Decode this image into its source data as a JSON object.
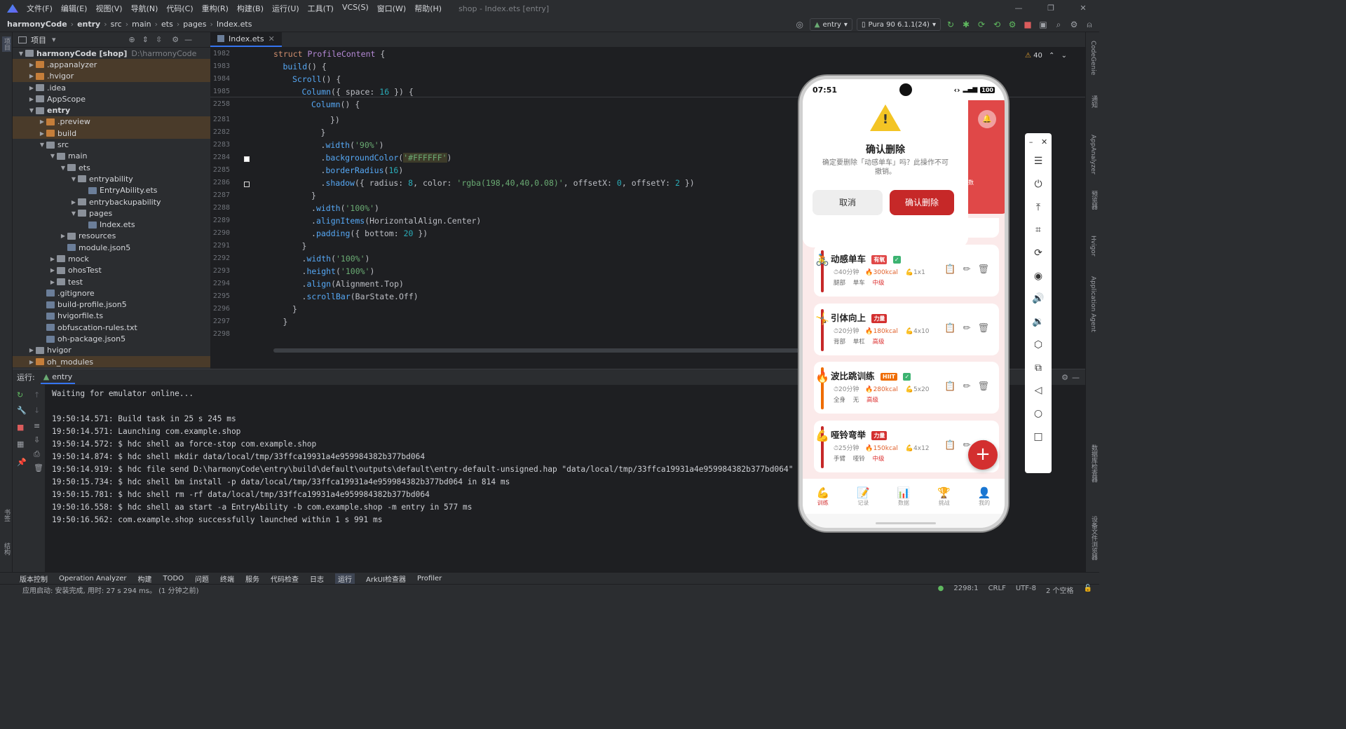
{
  "menu": {
    "items": [
      "文件(F)",
      "编辑(E)",
      "视图(V)",
      "导航(N)",
      "代码(C)",
      "重构(R)",
      "构建(B)",
      "运行(U)",
      "工具(T)",
      "VCS(S)",
      "窗口(W)",
      "帮助(H)"
    ],
    "window_title": "shop - Index.ets [entry]"
  },
  "breadcrumb": [
    "harmonyCode",
    "entry",
    "src",
    "main",
    "ets",
    "pages",
    "Index.ets"
  ],
  "toolbar": {
    "run_config": "entry",
    "device": "Pura 90 6.1.1(24)"
  },
  "left_stripe": {
    "project": "项目",
    "bookmarks": "书签",
    "structure": "结构"
  },
  "project_panel": {
    "title": "项目"
  },
  "tree": [
    {
      "label": "harmonyCode [shop]",
      "sub": "D:\\harmonyCode",
      "depth": 0,
      "type": "dir",
      "open": true,
      "hl": false
    },
    {
      "label": ".appanalyzer",
      "depth": 1,
      "type": "dir-or",
      "open": false,
      "hl": true
    },
    {
      "label": ".hvigor",
      "depth": 1,
      "type": "dir-or",
      "open": false,
      "hl": true
    },
    {
      "label": ".idea",
      "depth": 1,
      "type": "dir",
      "open": false,
      "hl": false
    },
    {
      "label": "AppScope",
      "depth": 1,
      "type": "dir",
      "open": false,
      "hl": false
    },
    {
      "label": "entry",
      "depth": 1,
      "type": "dir",
      "open": true,
      "hl": false,
      "bold": true
    },
    {
      "label": ".preview",
      "depth": 2,
      "type": "dir-or",
      "open": false,
      "hl": true
    },
    {
      "label": "build",
      "depth": 2,
      "type": "dir-or",
      "open": false,
      "hl": true
    },
    {
      "label": "src",
      "depth": 2,
      "type": "dir",
      "open": true,
      "hl": false
    },
    {
      "label": "main",
      "depth": 3,
      "type": "dir",
      "open": true,
      "hl": false
    },
    {
      "label": "ets",
      "depth": 4,
      "type": "dir",
      "open": true,
      "hl": false
    },
    {
      "label": "entryability",
      "depth": 5,
      "type": "dir",
      "open": true,
      "hl": false
    },
    {
      "label": "EntryAbility.ets",
      "depth": 6,
      "type": "file",
      "open": null,
      "hl": false
    },
    {
      "label": "entrybackupability",
      "depth": 5,
      "type": "dir",
      "open": false,
      "hl": false
    },
    {
      "label": "pages",
      "depth": 5,
      "type": "dir",
      "open": true,
      "hl": false
    },
    {
      "label": "Index.ets",
      "depth": 6,
      "type": "file",
      "open": null,
      "hl": false
    },
    {
      "label": "resources",
      "depth": 4,
      "type": "dir",
      "open": false,
      "hl": false
    },
    {
      "label": "module.json5",
      "depth": 4,
      "type": "file",
      "open": null,
      "hl": false
    },
    {
      "label": "mock",
      "depth": 3,
      "type": "dir",
      "open": false,
      "hl": false
    },
    {
      "label": "ohosTest",
      "depth": 3,
      "type": "dir",
      "open": false,
      "hl": false
    },
    {
      "label": "test",
      "depth": 3,
      "type": "dir",
      "open": false,
      "hl": false
    },
    {
      "label": ".gitignore",
      "depth": 2,
      "type": "file",
      "open": null,
      "hl": false
    },
    {
      "label": "build-profile.json5",
      "depth": 2,
      "type": "file",
      "open": null,
      "hl": false
    },
    {
      "label": "hvigorfile.ts",
      "depth": 2,
      "type": "file",
      "open": null,
      "hl": false
    },
    {
      "label": "obfuscation-rules.txt",
      "depth": 2,
      "type": "file",
      "open": null,
      "hl": false
    },
    {
      "label": "oh-package.json5",
      "depth": 2,
      "type": "file",
      "open": null,
      "hl": false
    },
    {
      "label": "hvigor",
      "depth": 1,
      "type": "dir",
      "open": false,
      "hl": false
    },
    {
      "label": "oh_modules",
      "depth": 1,
      "type": "dir-or",
      "open": false,
      "hl": true
    }
  ],
  "editor": {
    "tab": "Index.ets",
    "warnings": "40",
    "lines": [
      {
        "n": "1982",
        "html": "<span class='kw'>struct</span> <span class='ty'>ProfileContent</span> <span class='pl'>{</span>",
        "indent": 0
      },
      {
        "n": "1983",
        "html": "<span class='fn'>build</span><span class='pl'>() {</span>",
        "indent": 1
      },
      {
        "n": "1984",
        "html": "<span class='fn'>Scroll</span><span class='pl'>() {</span>",
        "indent": 2
      },
      {
        "n": "1985",
        "html": "<span class='fn'>Column</span><span class='pl'>({ space: </span><span class='nu'>16</span><span class='pl'> }) {</span>",
        "indent": 3
      },
      {
        "n": "2258",
        "html": "<span class='fn'>Column</span><span class='pl'>() {</span>",
        "indent": 4
      },
      {
        "n": "2281",
        "html": "<span class='pl'>})</span>",
        "indent": 6
      },
      {
        "n": "2282",
        "html": "<span class='pl'>}</span>",
        "indent": 5
      },
      {
        "n": "2283",
        "html": "<span class='pl'>.</span><span class='fn'>width</span><span class='pl'>(</span><span class='st'>'90%'</span><span class='pl'>)</span>",
        "indent": 5
      },
      {
        "n": "2284",
        "html": "<span class='pl'>.</span><span class='fn'>backgroundColor</span><span class='pl'>(</span><span class='st' style='background:#3d3b2a'>'#FFFFFF'</span><span class='pl'>)</span>",
        "indent": 5
      },
      {
        "n": "2285",
        "html": "<span class='pl'>.</span><span class='fn'>borderRadius</span><span class='pl'>(</span><span class='nu'>16</span><span class='pl'>)</span>",
        "indent": 5
      },
      {
        "n": "2286",
        "html": "<span class='pl'>.</span><span class='fn'>shadow</span><span class='pl'>({ radius: </span><span class='nu'>8</span><span class='pl'>, color: </span><span class='st'>'rgba(198,40,40,0.08)'</span><span class='pl'>, offsetX: </span><span class='nu'>0</span><span class='pl'>, offsetY: </span><span class='nu'>2</span><span class='pl'> })</span>",
        "indent": 5
      },
      {
        "n": "2287",
        "html": "<span class='pl'>}</span>",
        "indent": 4
      },
      {
        "n": "2288",
        "html": "<span class='pl'>.</span><span class='fn'>width</span><span class='pl'>(</span><span class='st'>'100%'</span><span class='pl'>)</span>",
        "indent": 4
      },
      {
        "n": "2289",
        "html": "<span class='pl'>.</span><span class='fn'>alignItems</span><span class='pl'>(HorizontalAlign.Center)</span>",
        "indent": 4
      },
      {
        "n": "2290",
        "html": "<span class='pl'>.</span><span class='fn'>padding</span><span class='pl'>({ bottom: </span><span class='nu'>20</span><span class='pl'> })</span>",
        "indent": 4
      },
      {
        "n": "2291",
        "html": "<span class='pl'>}</span>",
        "indent": 3
      },
      {
        "n": "2292",
        "html": "<span class='pl'>.</span><span class='fn'>width</span><span class='pl'>(</span><span class='st'>'100%'</span><span class='pl'>)</span>",
        "indent": 3
      },
      {
        "n": "2293",
        "html": "<span class='pl'>.</span><span class='fn'>height</span><span class='pl'>(</span><span class='st'>'100%'</span><span class='pl'>)</span>",
        "indent": 3
      },
      {
        "n": "2294",
        "html": "<span class='pl'>.</span><span class='fn'>align</span><span class='pl'>(Alignment.Top)</span>",
        "indent": 3
      },
      {
        "n": "2295",
        "html": "<span class='pl'>.</span><span class='fn'>scrollBar</span><span class='pl'>(BarState.Off)</span>",
        "indent": 3
      },
      {
        "n": "2296",
        "html": "<span class='pl'>}</span>",
        "indent": 2
      },
      {
        "n": "2297",
        "html": "<span class='pl'>}</span>",
        "indent": 1
      },
      {
        "n": "2298",
        "html": "",
        "indent": 0
      }
    ]
  },
  "run": {
    "label": "运行:",
    "tab": "entry",
    "log": [
      "Waiting for emulator online...",
      "",
      "19:50:14.571: Build task in 25 s 245 ms",
      "19:50:14.571: Launching com.example.shop",
      "19:50:14.572: $ hdc shell aa force-stop com.example.shop",
      "19:50:14.874: $ hdc shell mkdir data/local/tmp/33ffca19931a4e959984382b377bd064",
      "19:50:14.919: $ hdc file send D:\\harmonyCode\\entry\\build\\default\\outputs\\default\\entry-default-unsigned.hap \"data/local/tmp/33ffca19931a4e959984382b377bd064\" in 45",
      "19:50:15.734: $ hdc shell bm install -p data/local/tmp/33ffca19931a4e959984382b377bd064 in 814 ms",
      "19:50:15.781: $ hdc shell rm -rf data/local/tmp/33ffca19931a4e959984382b377bd064",
      "19:50:16.558: $ hdc shell aa start -a EntryAbility -b com.example.shop -m entry in 577 ms",
      "19:50:16.562: com.example.shop successfully launched within 1 s 991 ms"
    ]
  },
  "bottom_tools": [
    "版本控制",
    "Operation Analyzer",
    "构建",
    "TODO",
    "问题",
    "终端",
    "服务",
    "代码检查",
    "日志",
    "运行",
    "ArkUI检查器",
    "Profiler"
  ],
  "status": {
    "message": "应用启动: 安装完成, 用时: 27 s 294 ms。 (1 分钟之前)",
    "position": "2298:1",
    "line_sep": "CRLF",
    "encoding": "UTF-8",
    "indent": "2 个空格"
  },
  "right_stripe": [
    "CodeGenie",
    "通知",
    "AppAnalyzer",
    "预览器",
    "Hvigor",
    "Application Agent",
    "数据库检查器",
    "设备文件浏览器"
  ],
  "phone": {
    "time": "07:51",
    "battery": "100",
    "dialog": {
      "title": "确认删除",
      "message": "确定要删除「动感单车」吗？此操作不可撤销。",
      "cancel": "取消",
      "confirm": "确认删除"
    },
    "peek_text": "数",
    "cards": [
      {
        "title": "动感单车",
        "tag": "有氧",
        "tag_color": "#e04848",
        "check": true,
        "bar": "#c62828",
        "time": "40分钟",
        "kcal": "300kcal",
        "sets": "1x1",
        "part": "腿部",
        "equip": "单车",
        "level": "中级",
        "emoji": "🚴"
      },
      {
        "title": "引体向上",
        "tag": "力量",
        "tag_color": "#d32f2f",
        "check": false,
        "bar": "#c62828",
        "time": "20分钟",
        "kcal": "180kcal",
        "sets": "4x10",
        "part": "背部",
        "equip": "单杠",
        "level": "高级",
        "emoji": "🤸"
      },
      {
        "title": "波比跳训练",
        "tag": "HIIT",
        "tag_color": "#ef6c00",
        "check": true,
        "bar": "#ef6c00",
        "time": "20分钟",
        "kcal": "280kcal",
        "sets": "5x20",
        "part": "全身",
        "equip": "无",
        "level": "高级",
        "emoji": "🔥"
      },
      {
        "title": "哑铃弯举",
        "tag": "力量",
        "tag_color": "#d32f2f",
        "check": false,
        "bar": "#c62828",
        "time": "25分钟",
        "kcal": "150kcal",
        "sets": "4x12",
        "part": "手臂",
        "equip": "哑铃",
        "level": "中级",
        "emoji": "💪"
      }
    ],
    "tabs": [
      {
        "label": "训练",
        "icon": "💪",
        "active": true
      },
      {
        "label": "记录",
        "icon": "📝",
        "active": false
      },
      {
        "label": "数据",
        "icon": "📊",
        "active": false
      },
      {
        "label": "挑战",
        "icon": "🏆",
        "active": false
      },
      {
        "label": "我的",
        "icon": "👤",
        "active": false
      }
    ]
  }
}
